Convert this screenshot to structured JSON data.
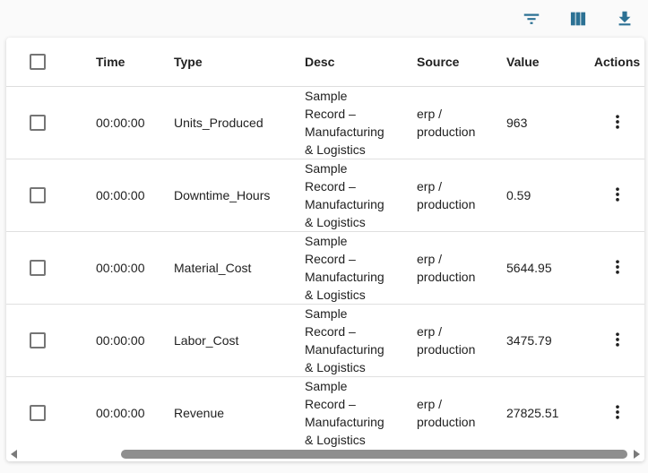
{
  "toolbar": {
    "icon_color": "#2c7194",
    "buttons": [
      {
        "name": "filter"
      },
      {
        "name": "columns"
      },
      {
        "name": "download"
      }
    ]
  },
  "table": {
    "headers": {
      "time": "Time",
      "type": "Type",
      "desc": "Desc",
      "source": "Source",
      "value": "Value",
      "actions": "Actions"
    },
    "rows": [
      {
        "time": "00:00:00",
        "type": "Units_Produced",
        "desc": "Sample Record – Manufacturing & Logistics",
        "source": "erp / production",
        "value": "963"
      },
      {
        "time": "00:00:00",
        "type": "Downtime_Hours",
        "desc": "Sample Record – Manufacturing & Logistics",
        "source": "erp / production",
        "value": "0.59"
      },
      {
        "time": "00:00:00",
        "type": "Material_Cost",
        "desc": "Sample Record – Manufacturing & Logistics",
        "source": "erp / production",
        "value": "5644.95"
      },
      {
        "time": "00:00:00",
        "type": "Labor_Cost",
        "desc": "Sample Record – Manufacturing & Logistics",
        "source": "erp / production",
        "value": "3475.79"
      },
      {
        "time": "00:00:00",
        "type": "Revenue",
        "desc": "Sample Record – Manufacturing & Logistics",
        "source": "erp / production",
        "value": "27825.51"
      }
    ]
  }
}
